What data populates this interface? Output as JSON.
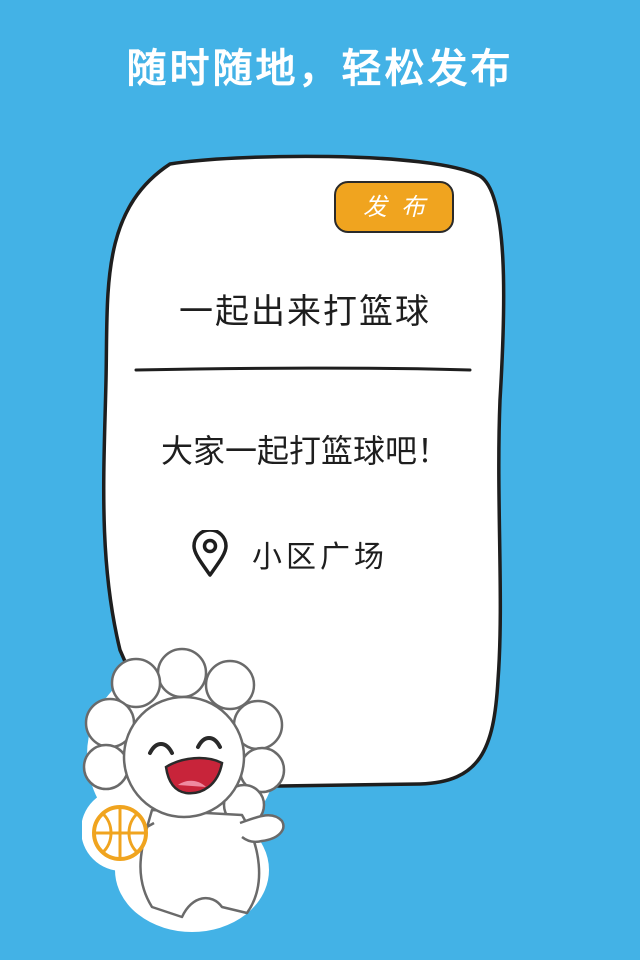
{
  "headline": "随时随地，轻松发布",
  "card": {
    "publish_button": "发布",
    "post_title": "一起出来打篮球",
    "post_body": "大家一起打篮球吧！",
    "location": "小区广场"
  },
  "icons": {
    "location": "map-pin-icon",
    "mascot": "mascot-with-basketball-icon"
  },
  "colors": {
    "background": "#43b2e6",
    "accent": "#f0a41f",
    "card": "#ffffff",
    "ink": "#1e1e1e"
  }
}
